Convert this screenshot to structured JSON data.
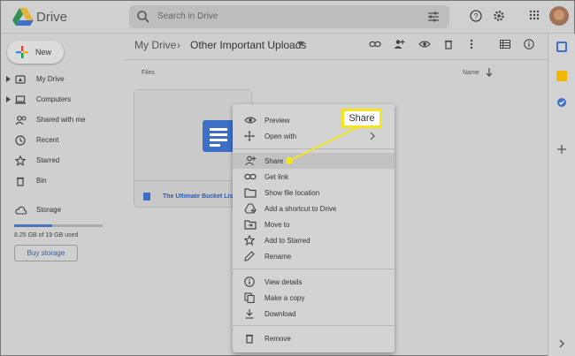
{
  "header": {
    "app_name": "Drive",
    "search_placeholder": "Search in Drive"
  },
  "sidebar": {
    "new_label": "New",
    "items": [
      {
        "label": "My Drive",
        "icon": "my-drive-icon"
      },
      {
        "label": "Computers",
        "icon": "computer-icon"
      },
      {
        "label": "Shared with me",
        "icon": "people-icon"
      },
      {
        "label": "Recent",
        "icon": "clock-icon"
      },
      {
        "label": "Starred",
        "icon": "star-icon"
      },
      {
        "label": "Bin",
        "icon": "trash-icon"
      }
    ],
    "storage_label": "Storage",
    "storage_used": "8.25 GB of 19 GB used",
    "storage_fraction": 0.43,
    "buy_storage": "Buy storage"
  },
  "breadcrumb": {
    "root": "My Drive",
    "separator": "›",
    "current": "Other Important Uploads"
  },
  "files_section": {
    "files_label": "Files",
    "sort_label": "Name",
    "file_name": "The Ultimate Bucket List"
  },
  "context_menu": {
    "items": [
      {
        "label": "Preview",
        "icon": "eye-icon"
      },
      {
        "label": "Open with",
        "icon": "move-arrows-icon"
      },
      {
        "label": "Share",
        "icon": "person-add-icon"
      },
      {
        "label": "Get link",
        "icon": "link-icon"
      },
      {
        "label": "Show file location",
        "icon": "folder-icon"
      },
      {
        "label": "Add a shortcut to Drive",
        "icon": "add-shortcut-icon"
      },
      {
        "label": "Move to",
        "icon": "move-to-icon"
      },
      {
        "label": "Add to Starred",
        "icon": "star-icon"
      },
      {
        "label": "Rename",
        "icon": "pencil-icon"
      },
      {
        "label": "View details",
        "icon": "info-icon"
      },
      {
        "label": "Make a copy",
        "icon": "copy-icon"
      },
      {
        "label": "Download",
        "icon": "download-icon"
      },
      {
        "label": "Remove",
        "icon": "trash-icon"
      }
    ]
  },
  "callout": {
    "text": "Share",
    "color": "#f5e51f"
  },
  "colors": {
    "accent": "#3d6fc7",
    "highlight": "#f5e51f"
  }
}
